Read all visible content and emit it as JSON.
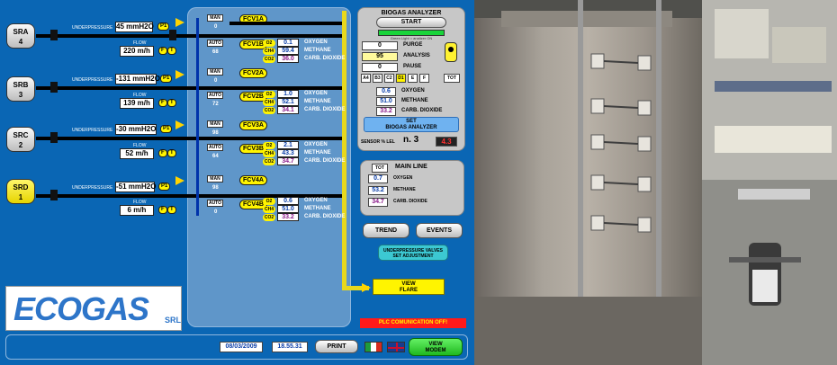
{
  "sources": [
    {
      "id": "SRA",
      "num": "4",
      "underpressure_label": "UNDERPRESSURE",
      "underpressure": "45 mmH2O",
      "flow_label": "FLOW",
      "flow": "220 m/h",
      "p_tag": "P1",
      "f_tag": "F",
      "t_tag": "T",
      "active": false
    },
    {
      "id": "SRB",
      "num": "3",
      "underpressure_label": "UNDERPRESSURE",
      "underpressure": "-131 mmH2O",
      "flow_label": "FLOW",
      "flow": "139 m/h",
      "p_tag": "P1",
      "f_tag": "F",
      "t_tag": "T",
      "active": false
    },
    {
      "id": "SRC",
      "num": "2",
      "underpressure_label": "UNDERPRESSURE",
      "underpressure": "-30 mmH2O",
      "flow_label": "FLOW",
      "flow": "52 m/h",
      "p_tag": "P1",
      "f_tag": "F",
      "t_tag": "T",
      "active": false
    },
    {
      "id": "SRD",
      "num": "1",
      "underpressure_label": "UNDERPRESSURE",
      "underpressure": "-51 mmH2O",
      "flow_label": "FLOW",
      "flow": "6 m/h",
      "p_tag": "P1",
      "f_tag": "F",
      "t_tag": "T",
      "active": true
    }
  ],
  "lines": [
    {
      "fcv_a": "FCV1A",
      "fcv_b": "FCV1B",
      "man": "MAN",
      "auto": "AUTO",
      "a_val": "0",
      "b_val": "68",
      "o2": "0.1",
      "ch4": "59.4",
      "co2": "36.0"
    },
    {
      "fcv_a": "FCV2A",
      "fcv_b": "FCV2B",
      "man": "MAN",
      "auto": "AUTO",
      "a_val": "0",
      "b_val": "72",
      "o2": "1.0",
      "ch4": "52.1",
      "co2": "34.1"
    },
    {
      "fcv_a": "FCV3A",
      "fcv_b": "FCV3B",
      "man": "MAN",
      "auto": "AUTO",
      "a_val": "98",
      "b_val": "64",
      "o2": "2.1",
      "ch4": "43.3",
      "co2": "34.7"
    },
    {
      "fcv_a": "FCV4A",
      "fcv_b": "FCV4B",
      "man": "MAN",
      "auto": "AUTO",
      "a_val": "98",
      "b_val": "0",
      "o2": "0.6",
      "ch4": "51.0",
      "co2": "33.2"
    }
  ],
  "gas_tags": {
    "o2": "O2",
    "ch4": "CH4",
    "co2": "CO2"
  },
  "gas_names": {
    "oxygen": "OXYGEN",
    "methane": "METHANE",
    "carb": "CARB. DIOXIDE"
  },
  "analyzer": {
    "title": "BIOGAS ANALYZER",
    "start": "START",
    "note": "Green Light = analizer ON",
    "purge_val": "0",
    "purge_label": "PURGE",
    "analysis_val": "95",
    "analysis_label": "ANALYSIS",
    "pause_val": "0",
    "pause_label": "PAUSE",
    "selectors": [
      "A4",
      "B3",
      "C2",
      "D1",
      "E",
      "F"
    ],
    "tot": "TOT",
    "o2": "0.6",
    "ch4": "51.0",
    "co2": "33.2",
    "set_label": "SET\nBIOGAS ANALYZER",
    "sensor_label": "SENSOR % LEL",
    "sensor_n": "n. 3",
    "sensor_val": "4.3"
  },
  "mainline": {
    "tot": "TOT",
    "title": "MAIN LINE",
    "o2": "0.7",
    "ch4": "53.2",
    "co2": "34.7",
    "o2_label": "OXYGEN",
    "ch4_label": "METHANE",
    "co2_label": "CARB. DIOXIDE"
  },
  "buttons": {
    "trend": "TREND",
    "events": "EVENTS",
    "underpressure": "UNDERPRESSURE VALVES\nSET ADJUSTMENT",
    "flare": "VIEW\nFLARE",
    "plc": "PLC COMUNICATION OFF!",
    "print": "PRINT",
    "modem": "VIEW\nMODEM"
  },
  "status": {
    "date": "08/03/2009",
    "time": "18.55.31"
  },
  "logo": {
    "brand": "ECOGAS",
    "suffix": "SRL"
  },
  "colors": {
    "bg": "#0a66b4",
    "accent_yellow": "#fff400",
    "alarm_red": "#ff1a1a",
    "modem_green": "#2fd12f"
  }
}
